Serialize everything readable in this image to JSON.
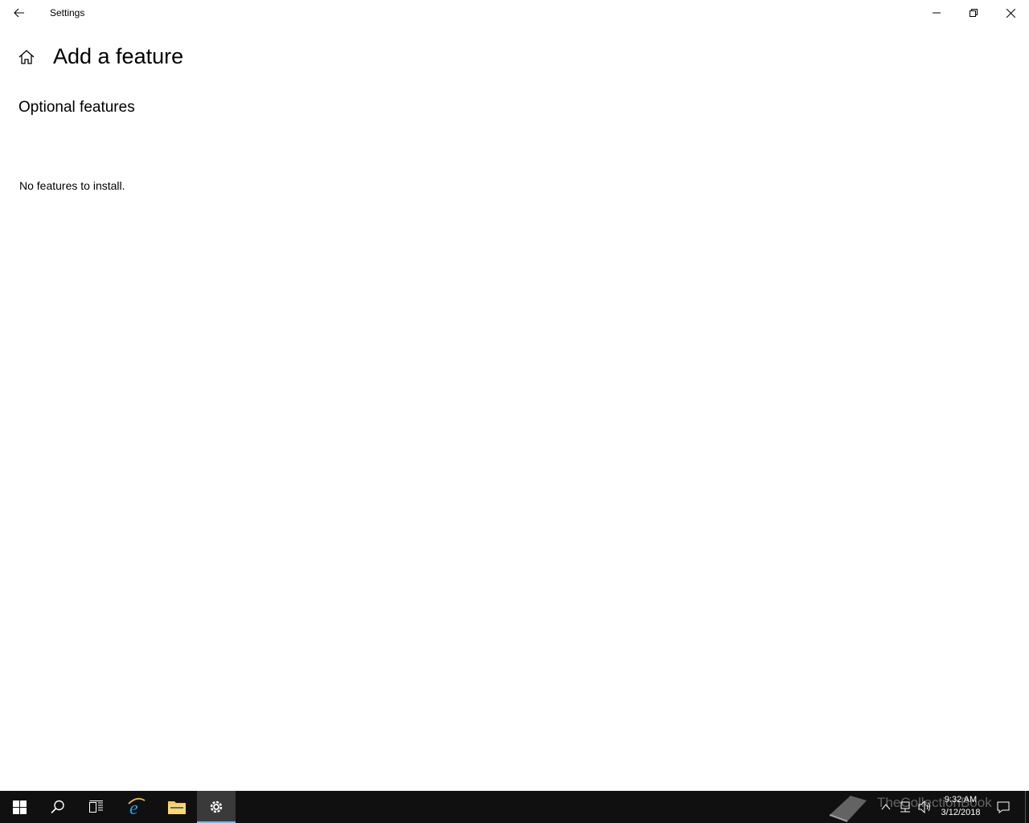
{
  "window": {
    "title": "Settings",
    "back_icon": "back-arrow-icon",
    "minimize_icon": "minimize-icon",
    "maximize_icon": "restore-icon",
    "close_icon": "close-icon"
  },
  "page": {
    "home_icon": "home-icon",
    "title": "Add a feature",
    "section_title": "Optional features",
    "empty_message": "No features to install."
  },
  "taskbar": {
    "items": [
      {
        "name": "start",
        "icon": "windows-logo-icon"
      },
      {
        "name": "search",
        "icon": "search-icon"
      },
      {
        "name": "task-view",
        "icon": "task-view-icon"
      },
      {
        "name": "internet-explorer",
        "icon": "internet-explorer-icon"
      },
      {
        "name": "file-explorer",
        "icon": "folder-icon"
      },
      {
        "name": "settings",
        "icon": "gear-icon",
        "active": true
      }
    ],
    "tray": {
      "chevron_icon": "chevron-up-icon",
      "network_icon": "network-icon",
      "volume_icon": "volume-icon",
      "notification_icon": "action-center-icon",
      "time": "9:32 AM",
      "date": "3/12/2018"
    },
    "watermark": "TheCollectionBook"
  },
  "colors": {
    "taskbar_bg": "#101010",
    "active_indicator": "#76b9ed",
    "window_bg": "#ffffff"
  }
}
